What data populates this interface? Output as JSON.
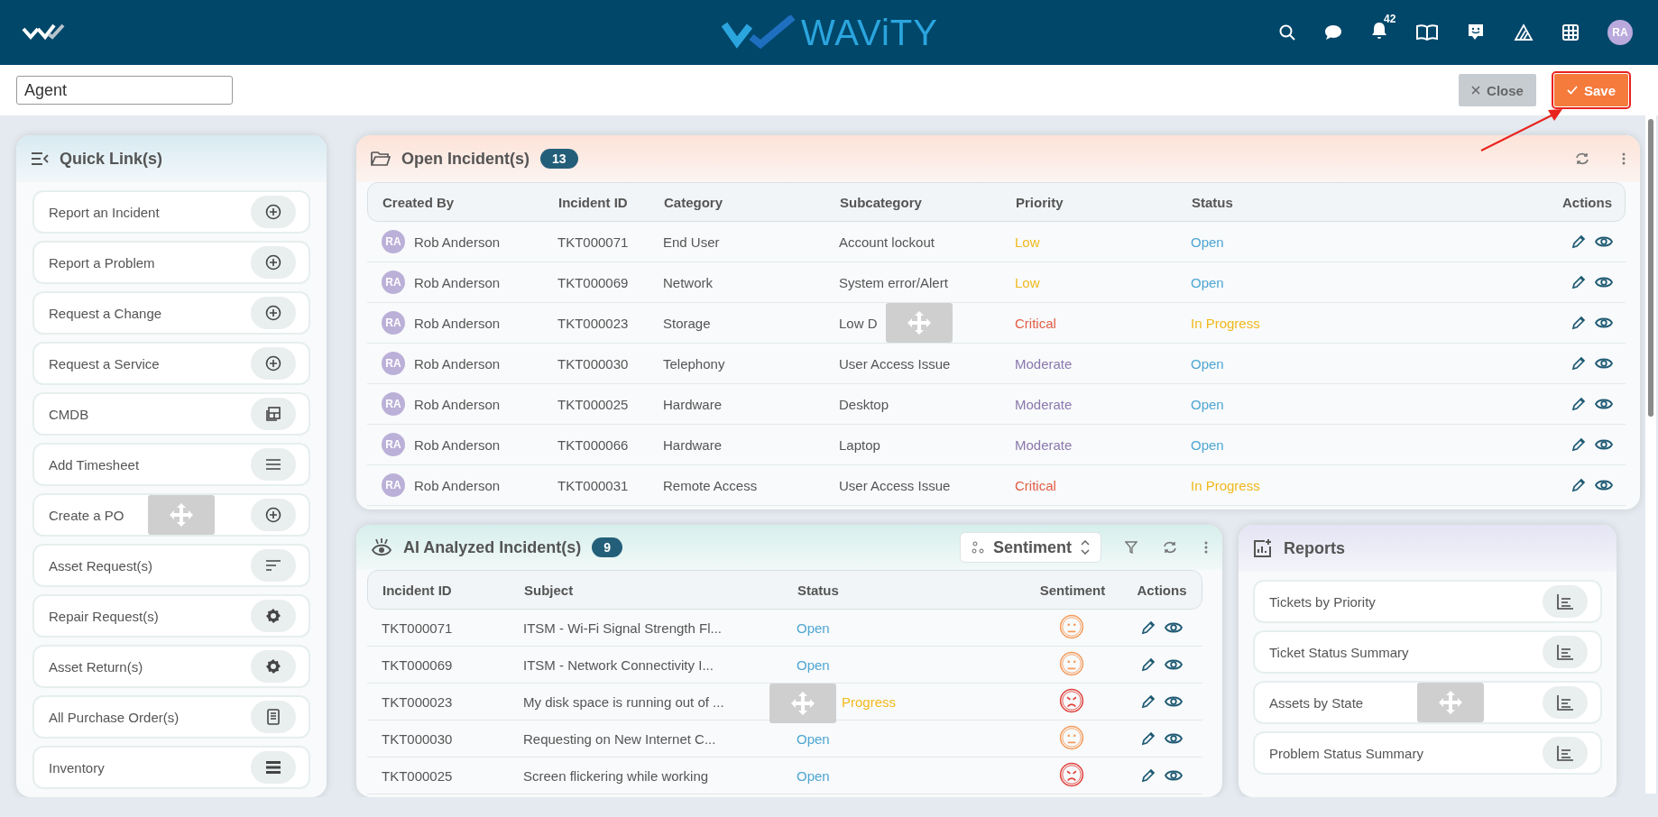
{
  "header": {
    "brand": "WAViTY",
    "notification_count": "42",
    "user_initials": "RA"
  },
  "toolbar": {
    "view_name": "Agent",
    "buttons": [
      {
        "label": "Close",
        "kind": "close",
        "highlighted": false
      },
      {
        "label": "Save",
        "kind": "save",
        "highlighted": true
      }
    ]
  },
  "quick_links": {
    "title": "Quick Link(s)",
    "items": [
      {
        "label": "Report an Incident",
        "kind": "plus"
      },
      {
        "label": "Report a Problem",
        "kind": "plus"
      },
      {
        "label": "Request a Change",
        "kind": "plus"
      },
      {
        "label": "Request a Service",
        "kind": "plus"
      },
      {
        "label": "CMDB",
        "kind": "layout"
      },
      {
        "label": "Add Timesheet",
        "kind": "lines"
      },
      {
        "label": "Create a PO",
        "kind": "plus"
      },
      {
        "label": "Asset Request(s)",
        "kind": "sort"
      },
      {
        "label": "Repair Request(s)",
        "kind": "gear"
      },
      {
        "label": "Asset Return(s)",
        "kind": "gear"
      },
      {
        "label": "All Purchase Order(s)",
        "kind": "document"
      },
      {
        "label": "Inventory",
        "kind": "list"
      }
    ]
  },
  "open_incidents": {
    "title": "Open Incident(s)",
    "count": "13",
    "columns": [
      "Created By",
      "Incident ID",
      "Category",
      "Subcategory",
      "Priority",
      "Status",
      "Actions"
    ],
    "rows": [
      {
        "initials": "RA",
        "created_by": "Rob Anderson",
        "incident_id": "TKT000071",
        "category": "End User",
        "subcategory": "Account lockout",
        "priority": {
          "label": "Low",
          "color": "#f2b81c"
        },
        "status": {
          "label": "Open",
          "color": "#4fa6d3"
        }
      },
      {
        "initials": "RA",
        "created_by": "Rob Anderson",
        "incident_id": "TKT000069",
        "category": "Network",
        "subcategory": "System error/Alert",
        "priority": {
          "label": "Low",
          "color": "#f2b81c"
        },
        "status": {
          "label": "Open",
          "color": "#4fa6d3"
        }
      },
      {
        "initials": "RA",
        "created_by": "Rob Anderson",
        "incident_id": "TKT000023",
        "category": "Storage",
        "subcategory": "Low D",
        "priority": {
          "label": "Critical",
          "color": "#e25d45"
        },
        "status": {
          "label": "In Progress",
          "color": "#f2b81c"
        }
      },
      {
        "initials": "RA",
        "created_by": "Rob Anderson",
        "incident_id": "TKT000030",
        "category": "Telephony",
        "subcategory": "User Access Issue",
        "priority": {
          "label": "Moderate",
          "color": "#8a78ad"
        },
        "status": {
          "label": "Open",
          "color": "#4fa6d3"
        }
      },
      {
        "initials": "RA",
        "created_by": "Rob Anderson",
        "incident_id": "TKT000025",
        "category": "Hardware",
        "subcategory": "Desktop",
        "priority": {
          "label": "Moderate",
          "color": "#8a78ad"
        },
        "status": {
          "label": "Open",
          "color": "#4fa6d3"
        }
      },
      {
        "initials": "RA",
        "created_by": "Rob Anderson",
        "incident_id": "TKT000066",
        "category": "Hardware",
        "subcategory": "Laptop",
        "priority": {
          "label": "Moderate",
          "color": "#8a78ad"
        },
        "status": {
          "label": "Open",
          "color": "#4fa6d3"
        }
      },
      {
        "initials": "RA",
        "created_by": "Rob Anderson",
        "incident_id": "TKT000031",
        "category": "Remote Access",
        "subcategory": "User Access Issue",
        "priority": {
          "label": "Critical",
          "color": "#e25d45"
        },
        "status": {
          "label": "In Progress",
          "color": "#f2b81c"
        }
      }
    ]
  },
  "ai_incidents": {
    "title": "AI Analyzed Incident(s)",
    "count": "9",
    "view_select": "Sentiment",
    "columns": [
      "Incident ID",
      "Subject",
      "Status",
      "Sentiment",
      "Actions"
    ],
    "rows": [
      {
        "incident_id": "TKT000071",
        "subject": "ITSM - Wi-Fi Signal Strength Fl...",
        "status": {
          "label": "Open",
          "color": "#4fa6d3"
        },
        "sentiment": {
          "kind": "neutral"
        }
      },
      {
        "incident_id": "TKT000069",
        "subject": "ITSM - Network Connectivity I...",
        "status": {
          "label": "Open",
          "color": "#4fa6d3"
        },
        "sentiment": {
          "kind": "neutral"
        }
      },
      {
        "incident_id": "TKT000023",
        "subject": "My disk space is running out of ...",
        "status": {
          "label": "Progress",
          "color": "#f2b81c"
        },
        "sentiment": {
          "kind": "negative"
        }
      },
      {
        "incident_id": "TKT000030",
        "subject": "Requesting on New Internet C...",
        "status": {
          "label": "Open",
          "color": "#4fa6d3"
        },
        "sentiment": {
          "kind": "neutral"
        }
      },
      {
        "incident_id": "TKT000025",
        "subject": "Screen flickering while working",
        "status": {
          "label": "Open",
          "color": "#4fa6d3"
        },
        "sentiment": {
          "kind": "negative"
        }
      }
    ]
  },
  "reports": {
    "title": "Reports",
    "items": [
      "Tickets by Priority",
      "Ticket Status Summary",
      "Assets by State",
      "Problem Status Summary"
    ]
  }
}
